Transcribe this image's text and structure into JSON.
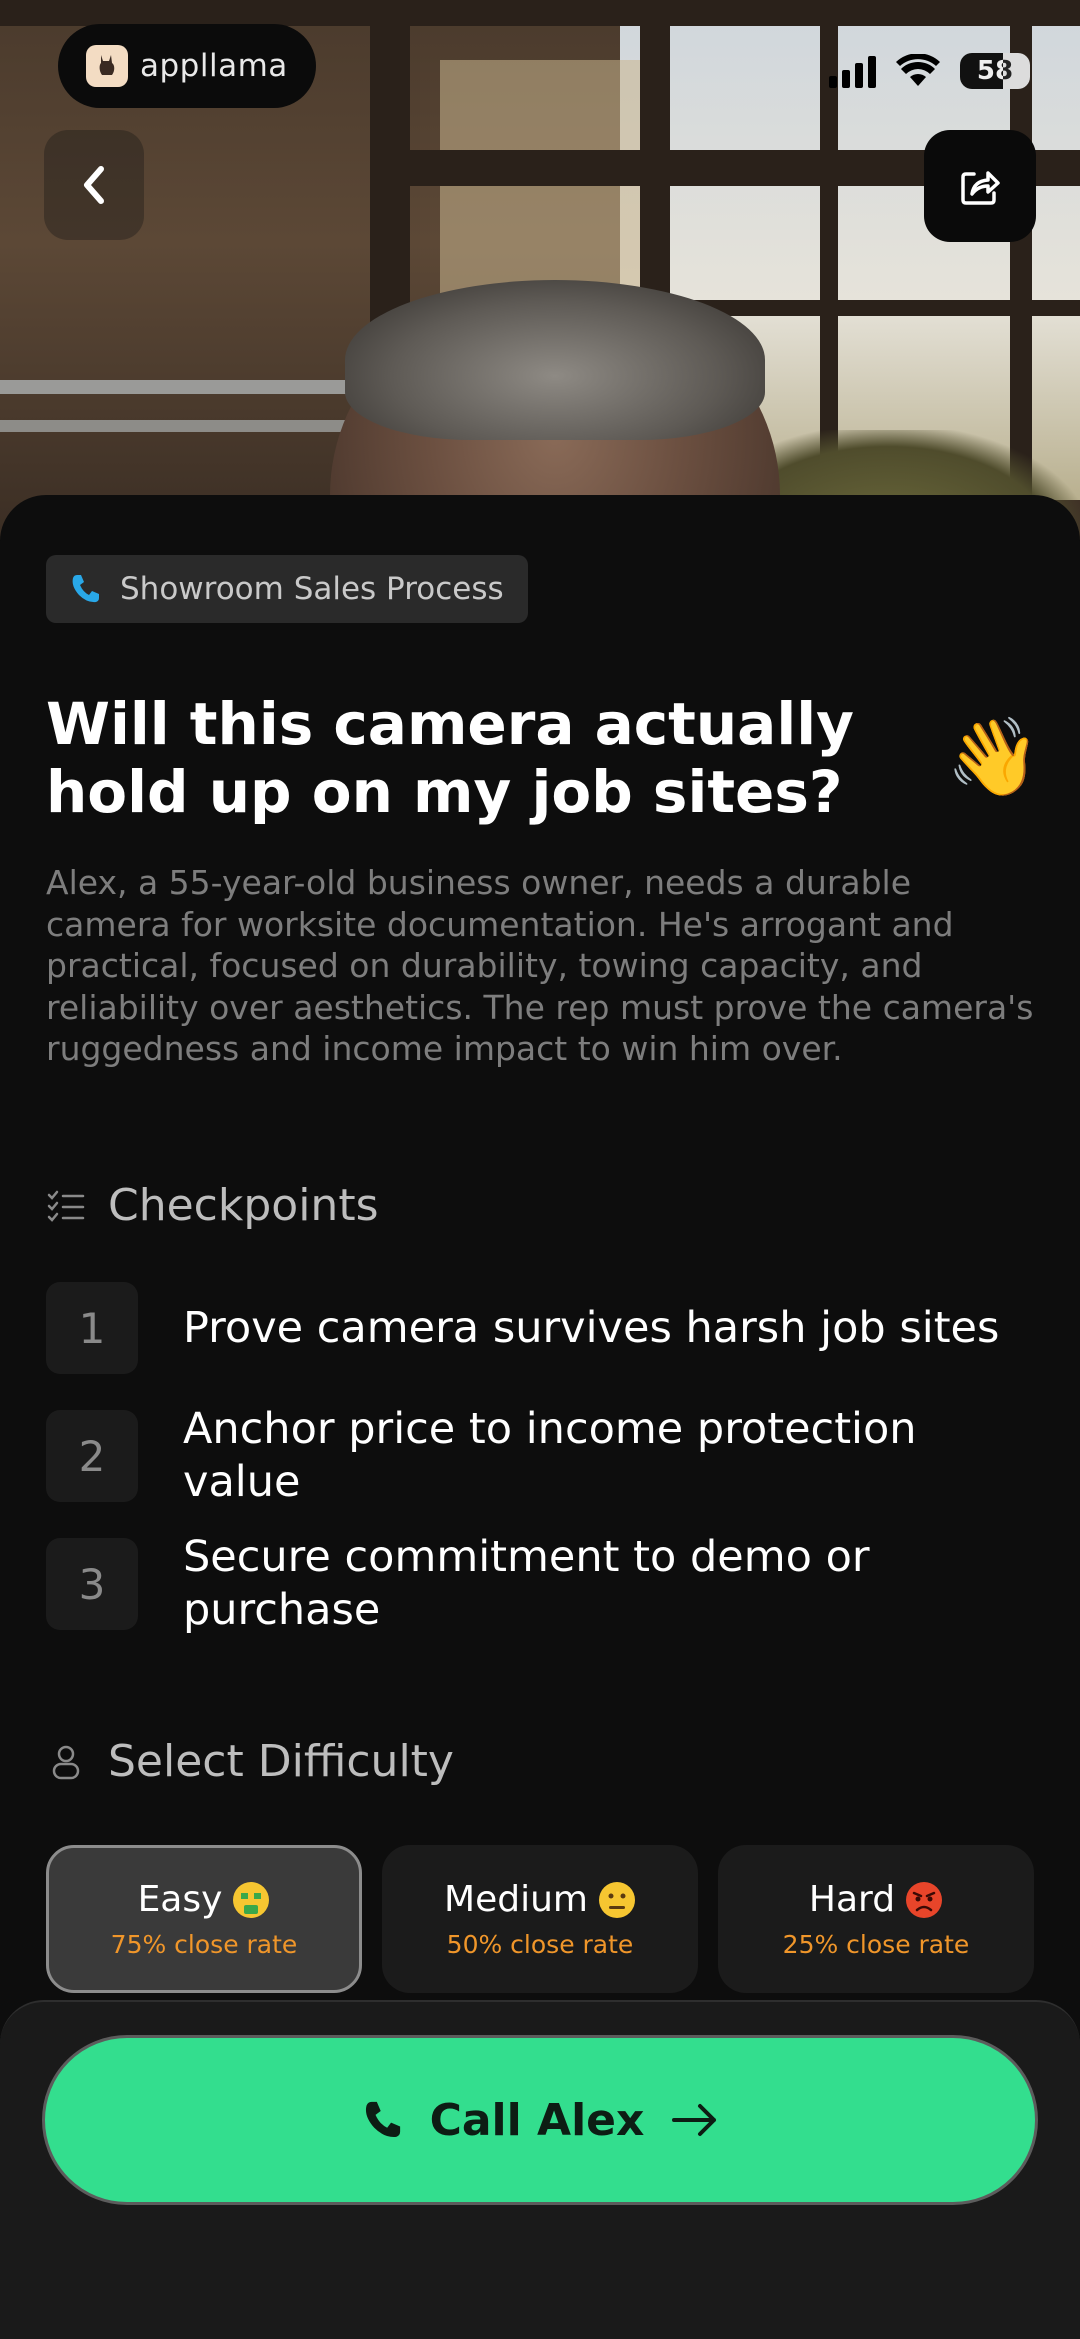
{
  "status_bar": {
    "brand": "appllama",
    "battery": "58"
  },
  "header": {
    "back_icon": "chevron-left-icon",
    "share_icon": "share-icon"
  },
  "scenario": {
    "tag": "Showroom Sales Process",
    "title": "Will this camera actually hold up on my job sites?",
    "emoji": "👋",
    "description": "Alex, a 55-year-old business owner, needs a durable camera for worksite documentation. He's arrogant and practical, focused on durability, towing capacity, and reliability over aesthetics. The rep must prove the camera's ruggedness and income impact to win him over."
  },
  "checkpoints": {
    "heading": "Checkpoints",
    "items": [
      {
        "num": "1",
        "text": "Prove camera survives harsh job sites"
      },
      {
        "num": "2",
        "text": "Anchor price to income protection value"
      },
      {
        "num": "3",
        "text": "Secure commitment to demo or purchase"
      }
    ]
  },
  "difficulty": {
    "heading": "Select Difficulty",
    "selected": "Easy",
    "options": [
      {
        "name": "Easy",
        "rate": "75% close rate",
        "emoji": "money-mouth-face-icon"
      },
      {
        "name": "Medium",
        "rate": "50% close rate",
        "emoji": "neutral-face-icon"
      },
      {
        "name": "Hard",
        "rate": "25% close rate",
        "emoji": "angry-face-icon"
      }
    ]
  },
  "cta": {
    "label": "Call Alex",
    "accent": "#33de8e"
  }
}
